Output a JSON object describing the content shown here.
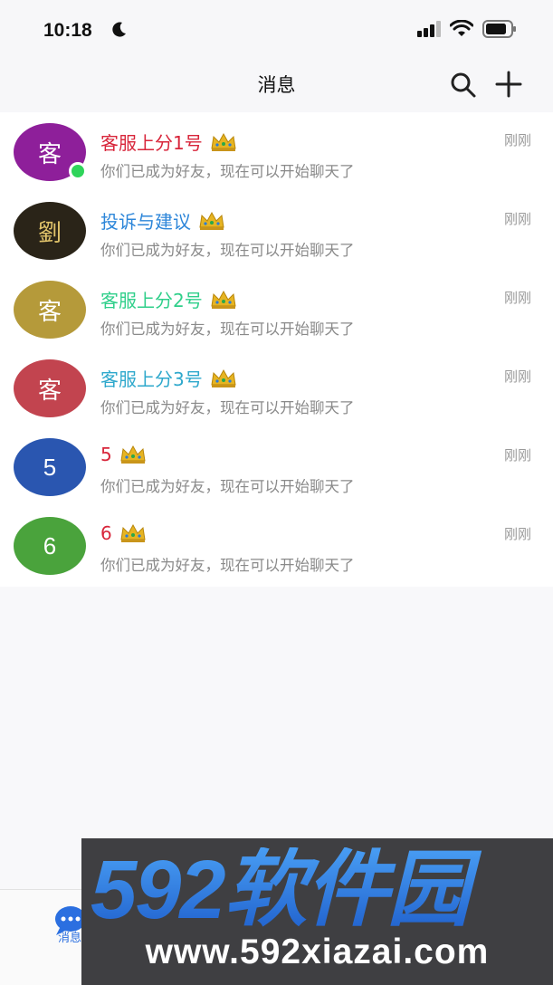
{
  "status_bar": {
    "time": "10:18",
    "icons": [
      "moon-icon",
      "signal-icon",
      "wifi-icon",
      "battery-icon"
    ]
  },
  "nav": {
    "title": "消息",
    "search_icon": "search-icon",
    "add_icon": "plus-icon"
  },
  "conversations": [
    {
      "name": "客服上分1号",
      "name_color": "#d8253a",
      "avatar_text": "客",
      "avatar_color": "#8e1f9a",
      "online": true,
      "preview": "你们已成为好友，现在可以开始聊天了",
      "time": "刚刚"
    },
    {
      "name": "投诉与建议",
      "name_color": "#2d86d9",
      "avatar_text": "劉",
      "avatar_color": "#2a2418",
      "online": false,
      "preview": "你们已成为好友，现在可以开始聊天了",
      "time": "刚刚"
    },
    {
      "name": "客服上分2号",
      "name_color": "#2fcf8a",
      "avatar_text": "客",
      "avatar_color": "#b59a3a",
      "online": false,
      "preview": "你们已成为好友，现在可以开始聊天了",
      "time": "刚刚"
    },
    {
      "name": "客服上分3号",
      "name_color": "#2ea8cc",
      "avatar_text": "客",
      "avatar_color": "#c2444f",
      "online": false,
      "preview": "你们已成为好友，现在可以开始聊天了",
      "time": "刚刚"
    },
    {
      "name": "5",
      "name_color": "#d8253a",
      "avatar_text": "5",
      "avatar_color": "#2a56b0",
      "online": false,
      "preview": "你们已成为好友，现在可以开始聊天了",
      "time": "刚刚"
    },
    {
      "name": "6",
      "name_color": "#d8253a",
      "avatar_text": "6",
      "avatar_color": "#4aa33c",
      "online": false,
      "preview": "你们已成为好友，现在可以开始聊天了",
      "time": "刚刚"
    }
  ],
  "tab_bar": {
    "message_label": "消息",
    "message_icon": "chat-bubble-icon",
    "accent": "#2b6fe0"
  },
  "watermark": {
    "brand": "592软件园",
    "url": "www.592xiazai.com",
    "brand_color": "#2f7de0"
  }
}
